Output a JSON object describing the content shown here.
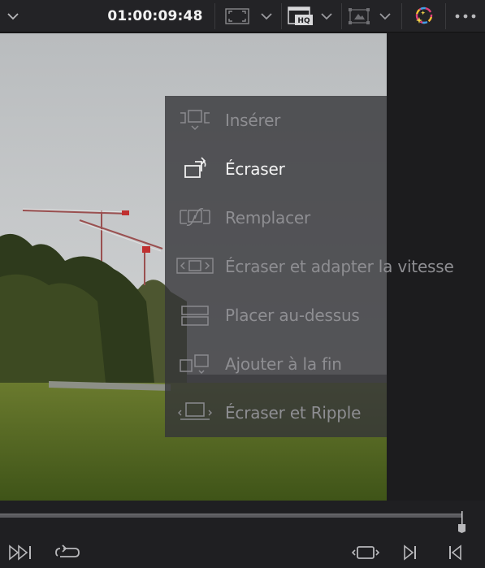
{
  "toolbar": {
    "timecode": "01:00:09:48",
    "icons": [
      "chevron-down-icon",
      "safe-area-icon",
      "proxy-hq-icon",
      "overlay-transform-icon",
      "color-wheel-icon",
      "more-icon"
    ],
    "hq_badge": "HQ",
    "colors": {
      "background": "#232326",
      "timecode": "#f2f2f2"
    }
  },
  "edit_overlay": {
    "items": [
      {
        "label": "Insérer",
        "icon": "insert-icon",
        "active": false
      },
      {
        "label": "Écraser",
        "icon": "overwrite-icon",
        "active": true
      },
      {
        "label": "Remplacer",
        "icon": "replace-icon",
        "active": false
      },
      {
        "label": "Écraser et adapter la vitesse",
        "icon": "fit-to-fill-icon",
        "active": false
      },
      {
        "label": "Placer au-dessus",
        "icon": "place-on-top-icon",
        "active": false
      },
      {
        "label": "Ajouter à la fin",
        "icon": "append-at-end-icon",
        "active": false
      },
      {
        "label": "Écraser et Ripple",
        "icon": "ripple-overwrite-icon",
        "active": false
      }
    ],
    "colors": {
      "active_label": "#f4f4f4",
      "inactive_label": "#8e8e92"
    }
  },
  "transport": {
    "icons": [
      "skip-to-end-icon",
      "loop-icon",
      "match-frame-icon",
      "mark-out-icon",
      "mark-in-icon"
    ],
    "scrub_position_fraction": 0.95
  }
}
